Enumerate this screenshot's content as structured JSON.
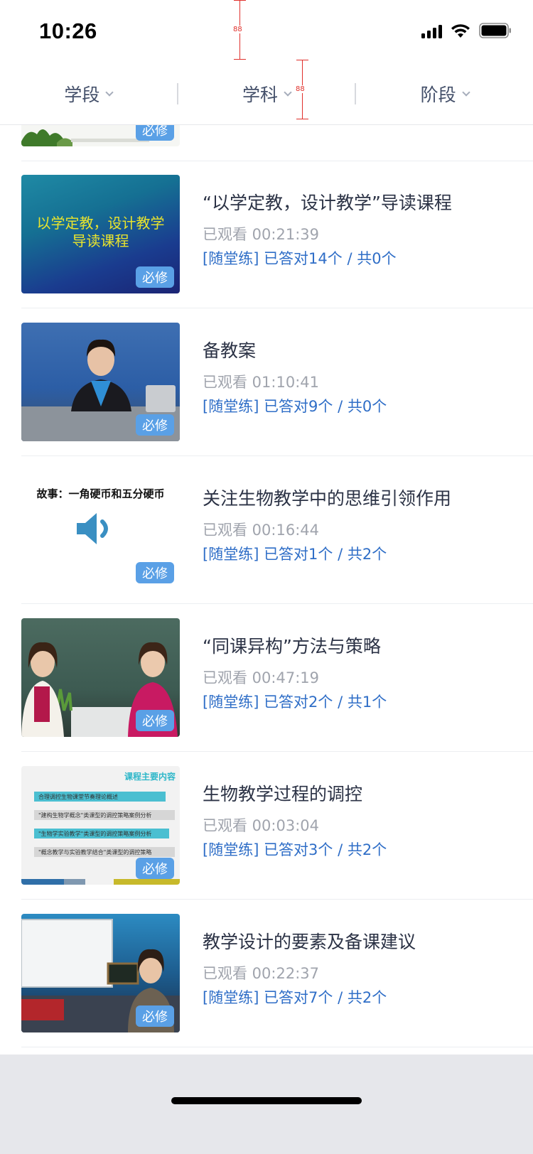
{
  "status_bar": {
    "time": "10:26"
  },
  "guides": {
    "left_label": "88",
    "right_label": "88"
  },
  "filters": [
    {
      "label": "学段"
    },
    {
      "label": "学科"
    },
    {
      "label": "阶段"
    }
  ],
  "thumbnails": {
    "blue_slide_line1": "以学定教，设计教学",
    "blue_slide_line2": "导读课程",
    "audio_slide_title": "故事：一角硬币和五分硬币",
    "slides_header": "课程主要内容",
    "slides_bars": [
      "合理调控生物课堂节奏理论概述",
      "\"建构生物学概念\"类课型的调控策略案例分析",
      "\"生物学实验教学\"类课型的调控策略案例分析",
      "\"概念教学与实验教学结合\"类课型的调控策略"
    ]
  },
  "courses": [
    {
      "badge": "必修",
      "title": "",
      "watched": "",
      "practice": ""
    },
    {
      "badge": "必修",
      "title": "“以学定教，设计教学”导读课程",
      "watched": "已观看 00:21:39",
      "practice": "[随堂练] 已答对14个 / 共0个"
    },
    {
      "badge": "必修",
      "title": "备教案",
      "watched": "已观看 01:10:41",
      "practice": "[随堂练] 已答对9个 / 共0个"
    },
    {
      "badge": "必修",
      "title": "关注生物教学中的思维引领作用",
      "watched": "已观看 00:16:44",
      "practice": "[随堂练] 已答对1个 / 共2个"
    },
    {
      "badge": "必修",
      "title": "“同课异构”方法与策略",
      "watched": "已观看 00:47:19",
      "practice": "[随堂练] 已答对2个 / 共1个"
    },
    {
      "badge": "必修",
      "title": "生物教学过程的调控",
      "watched": "已观看 00:03:04",
      "practice": "[随堂练] 已答对3个 / 共2个"
    },
    {
      "badge": "必修",
      "title": "教学设计的要素及备课建议",
      "watched": "已观看 00:22:37",
      "practice": "[随堂练] 已答对7个 / 共2个"
    }
  ]
}
